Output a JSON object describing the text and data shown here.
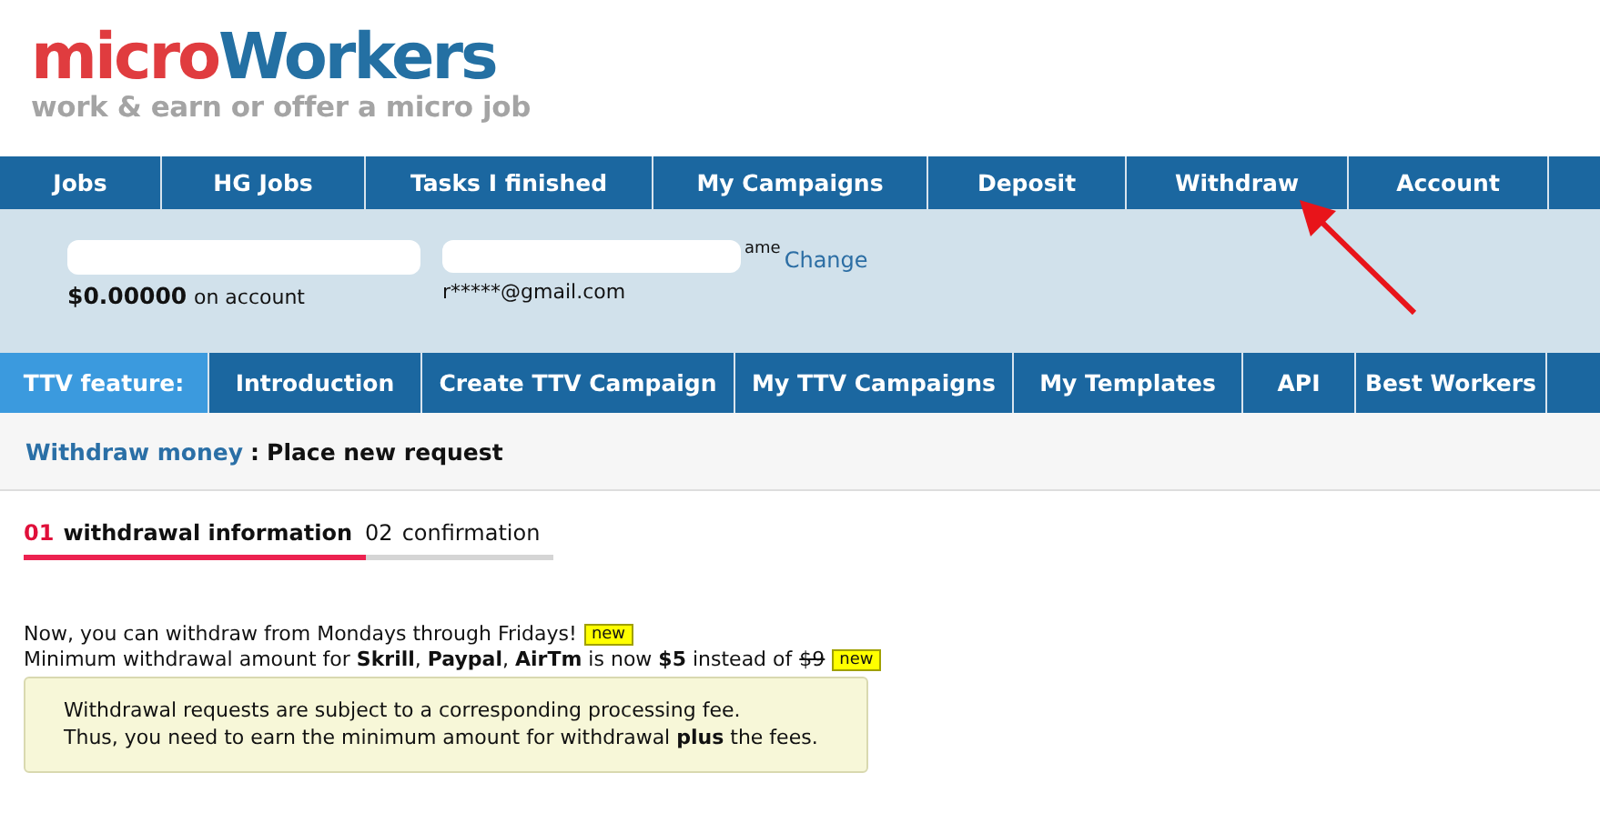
{
  "logo": {
    "brand_first": "micro",
    "brand_second": "Workers",
    "tagline": "work & earn or offer a micro job"
  },
  "main_nav": [
    {
      "label": "Jobs",
      "selected": false
    },
    {
      "label": "HG Jobs",
      "selected": false
    },
    {
      "label": "Tasks I finished",
      "selected": false
    },
    {
      "label": "My Campaigns",
      "selected": false
    },
    {
      "label": "Deposit",
      "selected": false
    },
    {
      "label": "Withdraw",
      "selected": false
    },
    {
      "label": "Account",
      "selected": false
    }
  ],
  "account": {
    "balance": "$0.00000",
    "balance_suffix": "on account",
    "name_fragment": "ame",
    "change_link": "Change",
    "email": "r*****@gmail.com"
  },
  "ttv_nav": [
    {
      "label": "TTV feature:",
      "kind": "heading"
    },
    {
      "label": "Introduction",
      "kind": "link"
    },
    {
      "label": "Create TTV Campaign",
      "kind": "link"
    },
    {
      "label": "My TTV Campaigns",
      "kind": "link"
    },
    {
      "label": "My Templates",
      "kind": "link"
    },
    {
      "label": "API",
      "kind": "link"
    },
    {
      "label": "Best Workers",
      "kind": "link"
    }
  ],
  "breadcrumb": {
    "link": "Withdraw money",
    "separator": ":",
    "current": "Place new request"
  },
  "steps": [
    {
      "number": "01",
      "label": "withdrawal information",
      "selected": true
    },
    {
      "number": "02",
      "label": "confirmation",
      "selected": false
    }
  ],
  "notices": [
    {
      "text": "Now, you can withdraw from Mondays through Fridays!",
      "badge": "new"
    },
    {
      "text": "Minimum withdrawal amount for **Skrill**, **Paypal**, **AirTm** is now **$5** instead of",
      "old_value": "$9",
      "badge": "new"
    }
  ],
  "fee_note": [
    "Withdrawal requests are subject to a corresponding processing fee.",
    "Thus, you need to earn the minimum amount for withdrawal **plus** the fees."
  ]
}
